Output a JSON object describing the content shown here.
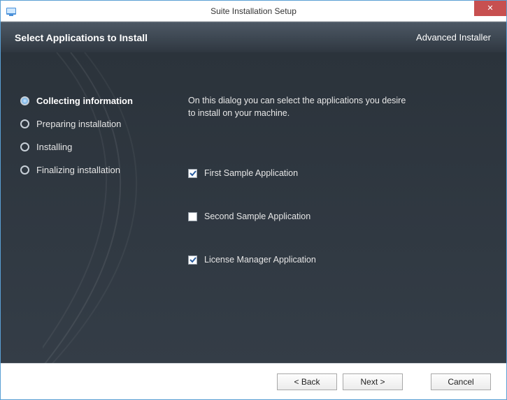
{
  "window": {
    "title": "Suite Installation Setup",
    "close_glyph": "✕"
  },
  "header": {
    "title": "Select Applications to Install",
    "brand": "Advanced Installer"
  },
  "sidebar": {
    "steps": [
      {
        "label": "Collecting information",
        "active": true
      },
      {
        "label": "Preparing installation",
        "active": false
      },
      {
        "label": "Installing",
        "active": false
      },
      {
        "label": "Finalizing installation",
        "active": false
      }
    ]
  },
  "main": {
    "intro": "On this dialog you can select the applications you desire to install on your machine.",
    "options": [
      {
        "label": "First Sample Application",
        "checked": true
      },
      {
        "label": "Second Sample Application",
        "checked": false
      },
      {
        "label": "License Manager Application",
        "checked": true
      }
    ]
  },
  "footer": {
    "back": "< Back",
    "next": "Next >",
    "cancel": "Cancel"
  }
}
